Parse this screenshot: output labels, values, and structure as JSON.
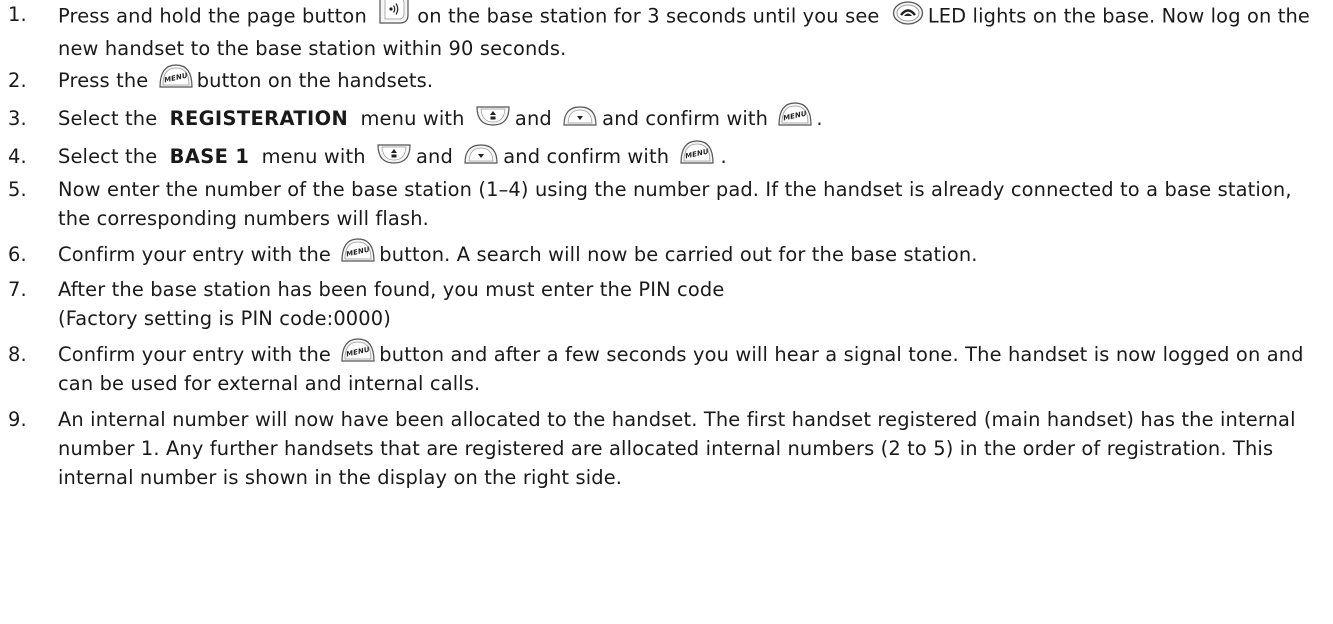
{
  "steps": [
    {
      "number": "1.",
      "a": "Press and hold the page button",
      "b": "on the base station for 3 seconds until you see",
      "c": "LED lights on the base. Now log on the new handset to the base station within 90 seconds."
    },
    {
      "number": "2.",
      "a": "Press the",
      "b": "button on the handsets."
    },
    {
      "number": "3.",
      "a": "Select the",
      "keyword": "REGISTERATION",
      "b": "menu with",
      "c": "and",
      "d": "and confirm with",
      "e": "."
    },
    {
      "number": "4.",
      "a": "Select the",
      "keyword": "BASE 1",
      "b": "menu with",
      "c": "and",
      "d": "and confirm with",
      "e": "."
    },
    {
      "number": "5.",
      "text": "Now enter the number of the base station (1–4) using the number pad. If the handset is already connected to a base station, the corresponding numbers will flash."
    },
    {
      "number": "6.",
      "a": "Confirm your entry with the",
      "b": "button. A search will now be carried out for the base station."
    },
    {
      "number": "7.",
      "line1": "After the base station has been found, you must enter the PIN code",
      "line2": "(Factory setting is PIN code:0000)"
    },
    {
      "number": "8.",
      "a": "Confirm your entry with the",
      "b": "button and after a few seconds you will hear a signal tone. The handset is now logged on and can be used for external and internal calls."
    },
    {
      "number": "9.",
      "text": "An internal number will now have been allocated to the handset. The first handset registered (main handset) has the internal number 1. Any further handsets that are registered are allocated internal numbers (2 to 5) in the order of registration. This internal number is shown in the display on the right side."
    }
  ],
  "icons": {
    "menu_label": "MENU",
    "page": "page-button-icon",
    "led": "base-led-icon",
    "menu": "menu-button-icon",
    "up": "up-key-icon",
    "down": "down-key-icon"
  }
}
